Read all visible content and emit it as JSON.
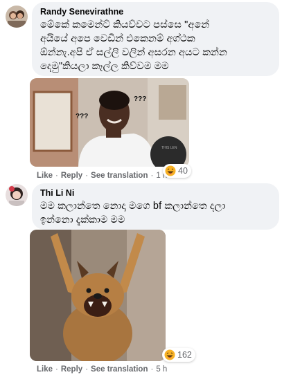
{
  "comments": [
    {
      "author": "Randy Senevirathne",
      "lines": [
        "මේකේ කමෙන්ට් කියව්වට පස්සෙ \"අනේ",
        "අයියේ අපෙ වෙඩින් එකෙනම් අග්ථක",
        "ඕන්නැ.අපි ඒ සල්ලි වලින් අසරන අයට කන්න",
        "දෙමු\"කියලා කෑල්ල කිව්වම මම"
      ],
      "image_label": "???",
      "image_watermark": "THIS LEN",
      "actions": {
        "like": "Like",
        "reply": "Reply",
        "see_translation": "See translation",
        "time": "1 h"
      },
      "reaction": {
        "icon": "haha-emoji-icon",
        "count": "40"
      }
    },
    {
      "author": "Thi Li Ni",
      "lines": [
        "මම කලාන්තෙ නොදා මගෙ bf කලාන්තෙ දලා",
        "ඉන්නො දැක්කාම මම"
      ],
      "actions": {
        "like": "Like",
        "reply": "Reply",
        "see_translation": "See translation",
        "time": "5 h"
      },
      "reaction": {
        "icon": "haha-emoji-icon",
        "count": "162"
      }
    }
  ],
  "colors": {
    "bubble": "#f0f2f5",
    "secondary_text": "#65676b",
    "primary_text": "#050505",
    "haha_yellow": "#f7b125"
  }
}
